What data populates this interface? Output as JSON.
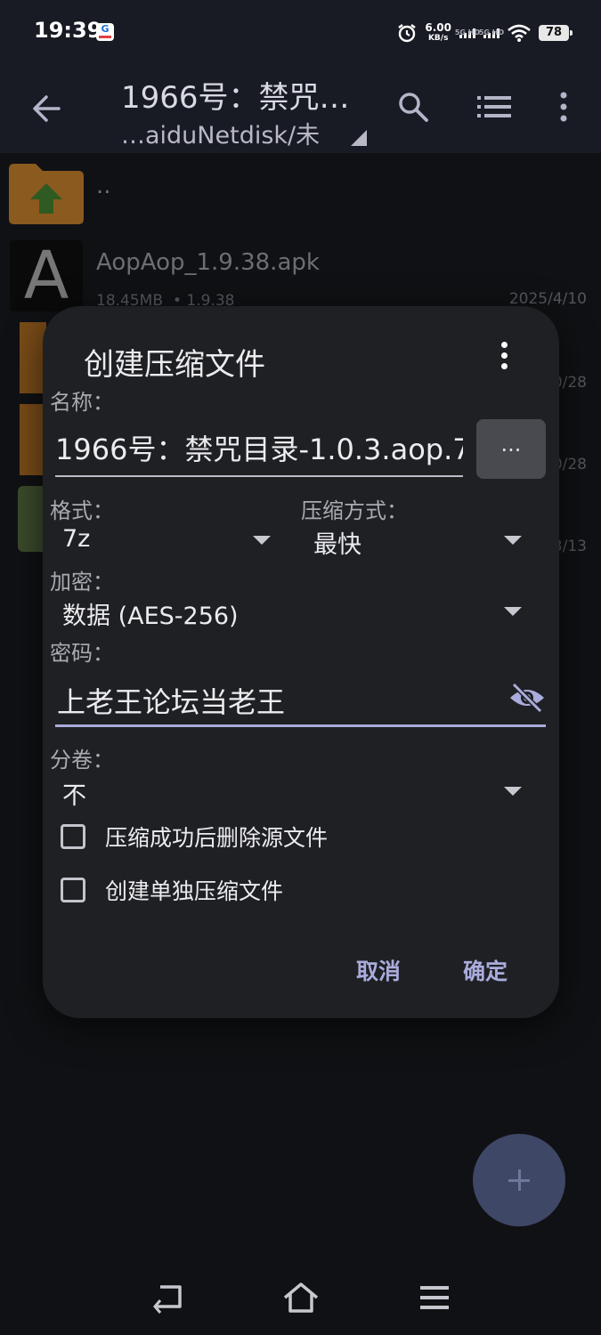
{
  "status_bar": {
    "time": "19:39",
    "speed_value": "6.00",
    "speed_unit": "KB/s",
    "sim1": "5G HD",
    "sim2": "5G HD",
    "battery": "78"
  },
  "app_bar": {
    "title": "1966号：禁咒…",
    "subtitle": "…aiduNetdisk/未",
    "icons": [
      "back-arrow-icon",
      "search-icon",
      "list-view-icon",
      "more-vert-icon"
    ]
  },
  "file_list": {
    "parent_label": "..",
    "items": [
      {
        "name": "AopAop_1.9.38.apk",
        "size": "18.45MB",
        "version": "• 1.9.38",
        "date": "2025/4/10"
      },
      {
        "date": "0/28"
      },
      {
        "date": "0/28"
      },
      {
        "date": "3/13"
      }
    ]
  },
  "dialog": {
    "title": "创建压缩文件",
    "name_label": "名称：",
    "name_value": "1966号：禁咒目录-1.0.3.aop.7",
    "browse_label": "...",
    "format_label": "格式：",
    "format_value": "7z",
    "method_label": "压缩方式：",
    "method_value": "最快",
    "encryption_label": "加密：",
    "encryption_value": "数据 (AES-256)",
    "password_label": "密码：",
    "password_value": "上老王论坛当老王",
    "split_label": "分卷：",
    "split_value": "不",
    "checkbox_delete_source": "压缩成功后删除源文件",
    "checkbox_separate": "创建单独压缩文件",
    "cancel_label": "取消",
    "ok_label": "确定"
  },
  "colors": {
    "accent": "#a9acdb",
    "dialog_bg": "#1f2024",
    "appbar_bg": "#181a24",
    "fab_bg": "#3e4766"
  }
}
